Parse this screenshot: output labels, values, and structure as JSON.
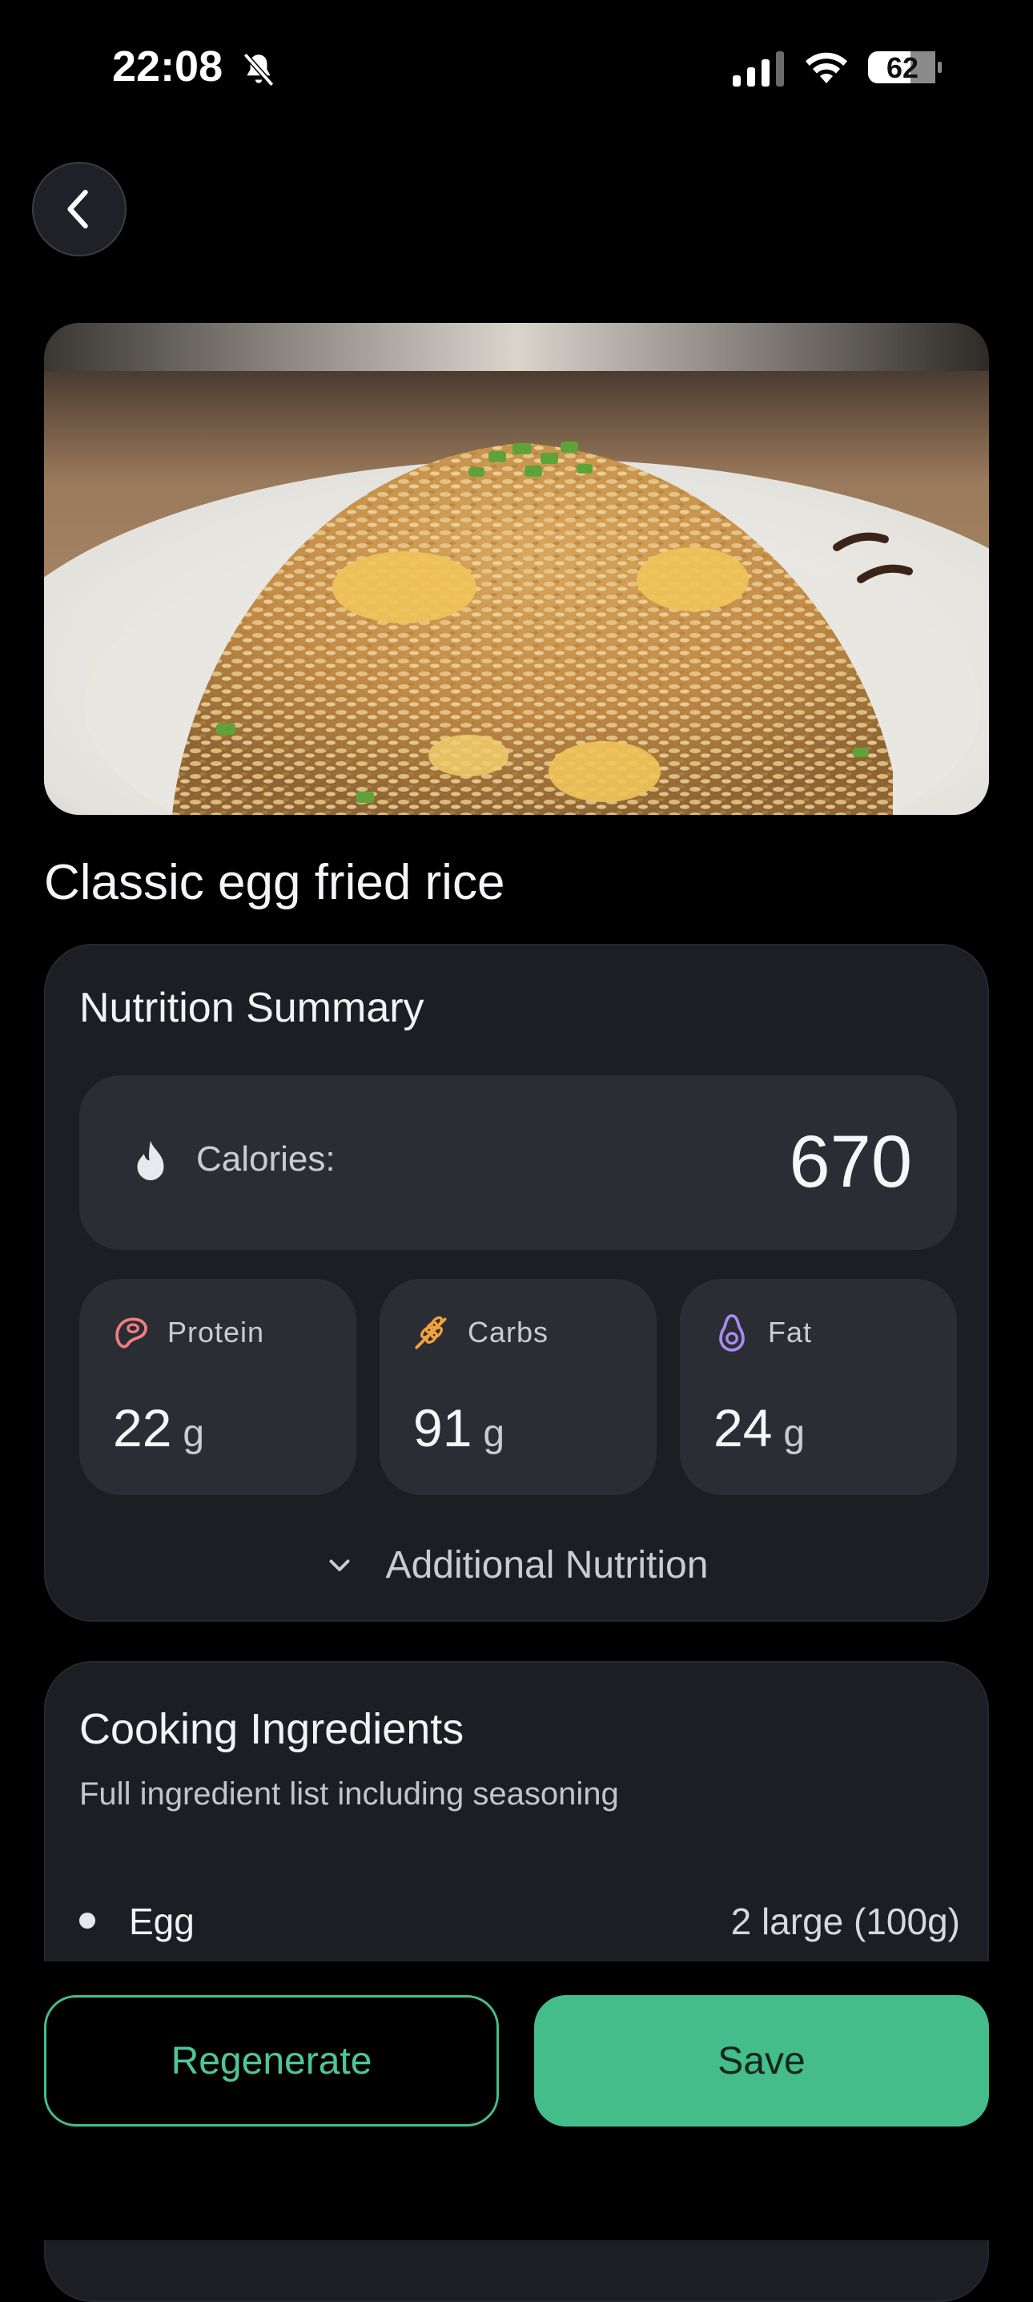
{
  "status_bar": {
    "time": "22:08",
    "battery_level": "62",
    "icons": [
      "bell-slash-icon",
      "cellular-signal-icon",
      "wifi-icon",
      "battery-icon"
    ]
  },
  "navigation": {
    "back_icon": "chevron-left-icon"
  },
  "hero_image": {
    "subject": "plate of egg fried rice"
  },
  "dish": {
    "title": "Classic egg fried rice"
  },
  "nutrition": {
    "title": "Nutrition Summary",
    "calories": {
      "icon": "flame-icon",
      "label": "Calories:",
      "value": "670"
    },
    "macros": [
      {
        "icon": "steak-icon",
        "label": "Protein",
        "value": "22",
        "unit": "g",
        "icon_color": "#f07f7f"
      },
      {
        "icon": "wheat-icon",
        "label": "Carbs",
        "value": "91",
        "unit": "g",
        "icon_color": "#f0a23c"
      },
      {
        "icon": "avocado-icon",
        "label": "Fat",
        "value": "24",
        "unit": "g",
        "icon_color": "#a98bf0"
      }
    ],
    "additional": {
      "icon": "chevron-down-icon",
      "label": "Additional Nutrition"
    }
  },
  "ingredients": {
    "title": "Cooking Ingredients",
    "subtitle": "Full ingredient list including seasoning",
    "items": [
      {
        "name": "Egg",
        "amount": "2 large (100g)"
      }
    ]
  },
  "actions": {
    "regenerate_label": "Regenerate",
    "save_label": "Save"
  },
  "colors": {
    "accent": "#44bd8a",
    "background": "#000000",
    "card": "#1c1e23",
    "inner_card": "#2a2d34"
  }
}
